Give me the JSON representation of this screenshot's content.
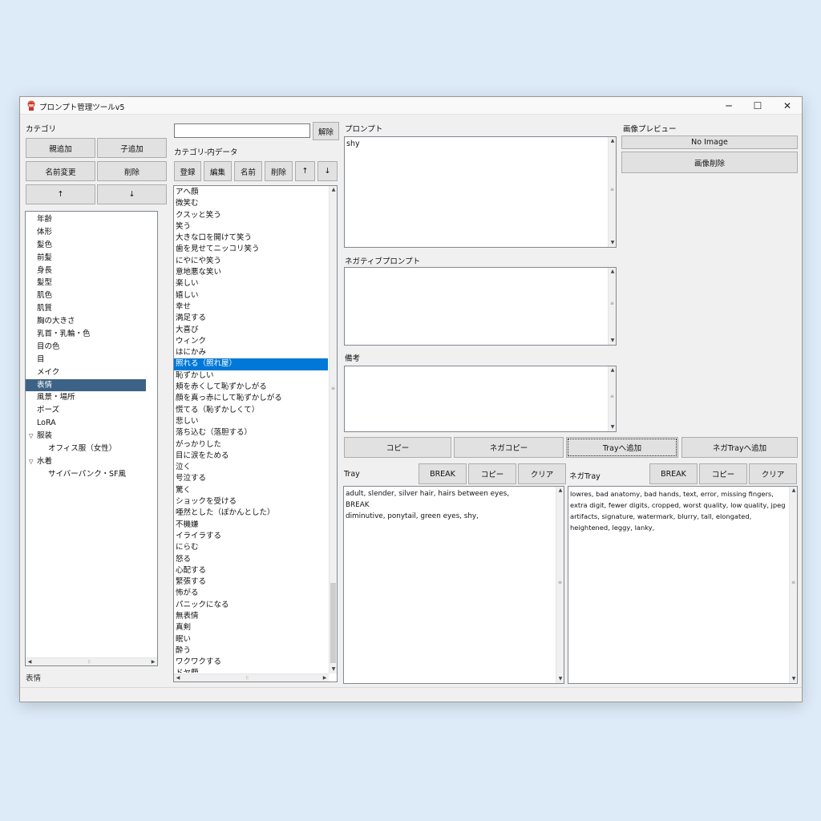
{
  "window": {
    "title": "プロンプト管理ツールv5",
    "minimize": "─",
    "maximize": "☐",
    "close": "✕"
  },
  "categories": {
    "label": "カテゴリ",
    "buttons": {
      "add_parent": "親追加",
      "add_child": "子追加",
      "rename": "名前変更",
      "delete": "削除",
      "up": "↑",
      "down": "↓"
    },
    "items": [
      {
        "label": "年齢"
      },
      {
        "label": "体形"
      },
      {
        "label": "髪色"
      },
      {
        "label": "前髪"
      },
      {
        "label": "身長"
      },
      {
        "label": "髪型"
      },
      {
        "label": "肌色"
      },
      {
        "label": "肌質"
      },
      {
        "label": "胸の大きさ"
      },
      {
        "label": "乳首・乳輪・色"
      },
      {
        "label": "目の色"
      },
      {
        "label": "目"
      },
      {
        "label": "メイク"
      },
      {
        "label": "表情",
        "selected": true
      },
      {
        "label": "風景・場所"
      },
      {
        "label": "ポーズ"
      },
      {
        "label": "LoRA"
      },
      {
        "label": "服装",
        "expanded": true
      },
      {
        "label": "オフィス服（女性）",
        "child": true
      },
      {
        "label": "水着",
        "expanded": true
      },
      {
        "label": "サイバーパンク・SF風",
        "child": true
      }
    ],
    "status": "表情"
  },
  "search": {
    "value": "",
    "clear_button": "解除"
  },
  "data_panel": {
    "label": "カテゴリ-内データ",
    "buttons": {
      "register": "登録",
      "edit": "編集",
      "name": "名前",
      "delete": "削除",
      "up": "↑",
      "down": "↓"
    },
    "items": [
      "アへ顔",
      "微笑む",
      "クスッと笑う",
      "笑う",
      "大きな口を開けて笑う",
      "歯を見せてニッコリ笑う",
      "にやにや笑う",
      "意地悪な笑い",
      "楽しい",
      "嬉しい",
      "幸せ",
      "満足する",
      "大喜び",
      "ウィンク",
      "はにかみ",
      "照れる（照れ屋）",
      "恥ずかしい",
      "頬を赤くして恥ずかしがる",
      "顔を真っ赤にして恥ずかしがる",
      "慌てる（恥ずかしくて）",
      "悲しい",
      "落ち込む（落胆する）",
      "がっかりした",
      "目に涙をためる",
      "泣く",
      "号泣する",
      "驚く",
      "ショックを受ける",
      "唖然とした（ぽかんとした）",
      "不機嫌",
      "イライラする",
      "にらむ",
      "怒る",
      "心配する",
      "緊張する",
      "怖がる",
      "パニックになる",
      "無表情",
      "真剣",
      "眠い",
      "酔う",
      "ワクワクする",
      "ドヤ顔"
    ],
    "selected_index": 15
  },
  "prompt": {
    "label": "プロンプト",
    "value": "shy"
  },
  "negative": {
    "label": "ネガティブプロンプト",
    "value": ""
  },
  "notes": {
    "label": "備考",
    "value": ""
  },
  "preview": {
    "label": "画像プレビュー",
    "no_image": "No Image",
    "delete_button": "画像削除"
  },
  "actions": {
    "copy": "コピー",
    "nega_copy": "ネガコピー",
    "add_tray": "Trayへ追加",
    "add_nega_tray": "ネガTrayへ追加"
  },
  "tray": {
    "label": "Tray",
    "break": "BREAK",
    "copy": "コピー",
    "clear": "クリア",
    "value": "adult, slender, silver hair, hairs between eyes,\nBREAK\ndiminutive, ponytail, green eyes, shy,"
  },
  "nega_tray": {
    "label": "ネガTray",
    "break": "BREAK",
    "copy": "コピー",
    "clear": "クリア",
    "value": "lowres, bad anatomy, bad hands, text, error, missing fingers, extra digit, fewer digits, cropped, worst quality, low quality, jpeg artifacts, signature, watermark, blurry, tall, elongated, heightened, leggy, lanky,"
  }
}
